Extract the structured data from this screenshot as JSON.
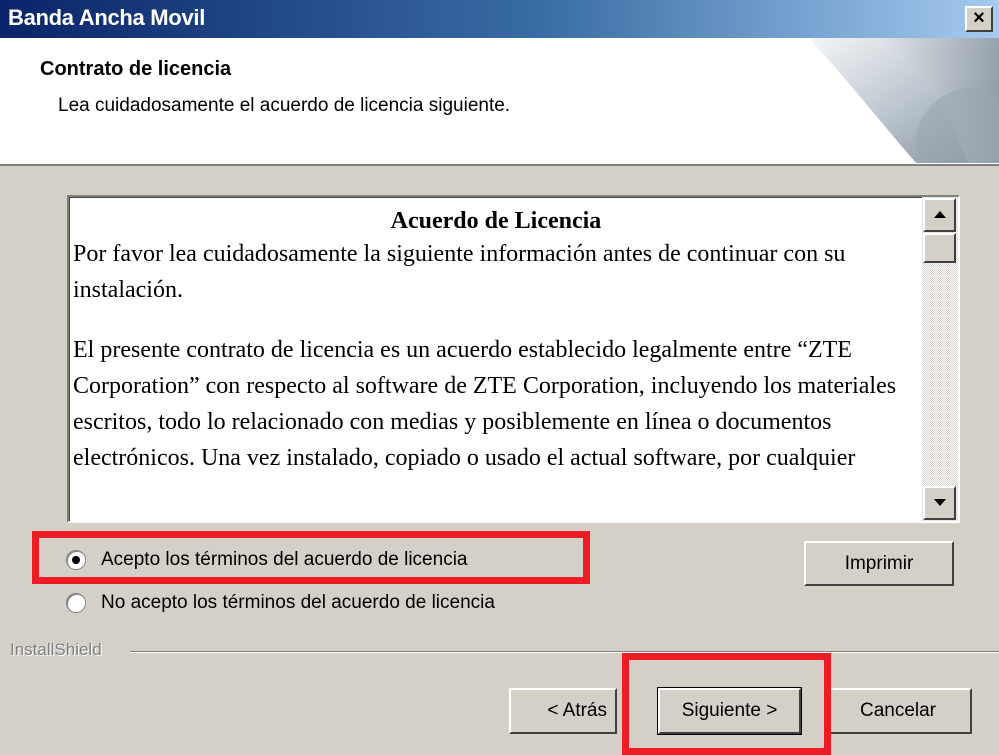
{
  "window": {
    "title": "Banda Ancha Movil",
    "close_label": "×"
  },
  "header": {
    "title": "Contrato de licencia",
    "subtitle": "Lea cuidadosamente el acuerdo de licencia siguiente."
  },
  "license": {
    "heading": "Acuerdo de Licencia",
    "paragraph1": "Por favor lea cuidadosamente la siguiente información antes de continuar con su instalación.",
    "paragraph2": "El presente contrato de licencia es un acuerdo establecido legalmente entre “ZTE Corporation” con respecto al software de ZTE Corporation, incluyendo  los materiales escritos, todo lo relacionado con medias y posiblemente en línea o documentos electrónicos. Una vez instalado, copiado o usado el actual software, por cualquier"
  },
  "options": {
    "accept_label": "Acepto los términos del acuerdo de licencia",
    "decline_label": "No acepto los términos del acuerdo de licencia",
    "selected": "accept"
  },
  "buttons": {
    "print": "Imprimir",
    "back": "< Atrás",
    "next": "Siguiente >",
    "cancel": "Cancelar"
  },
  "footer": {
    "brand": "InstallShield"
  },
  "colors": {
    "highlight": "#ee1c25",
    "titlebar_start": "#0a246a",
    "titlebar_end": "#a6caf0",
    "dialog_bg": "#d4d0c8"
  }
}
